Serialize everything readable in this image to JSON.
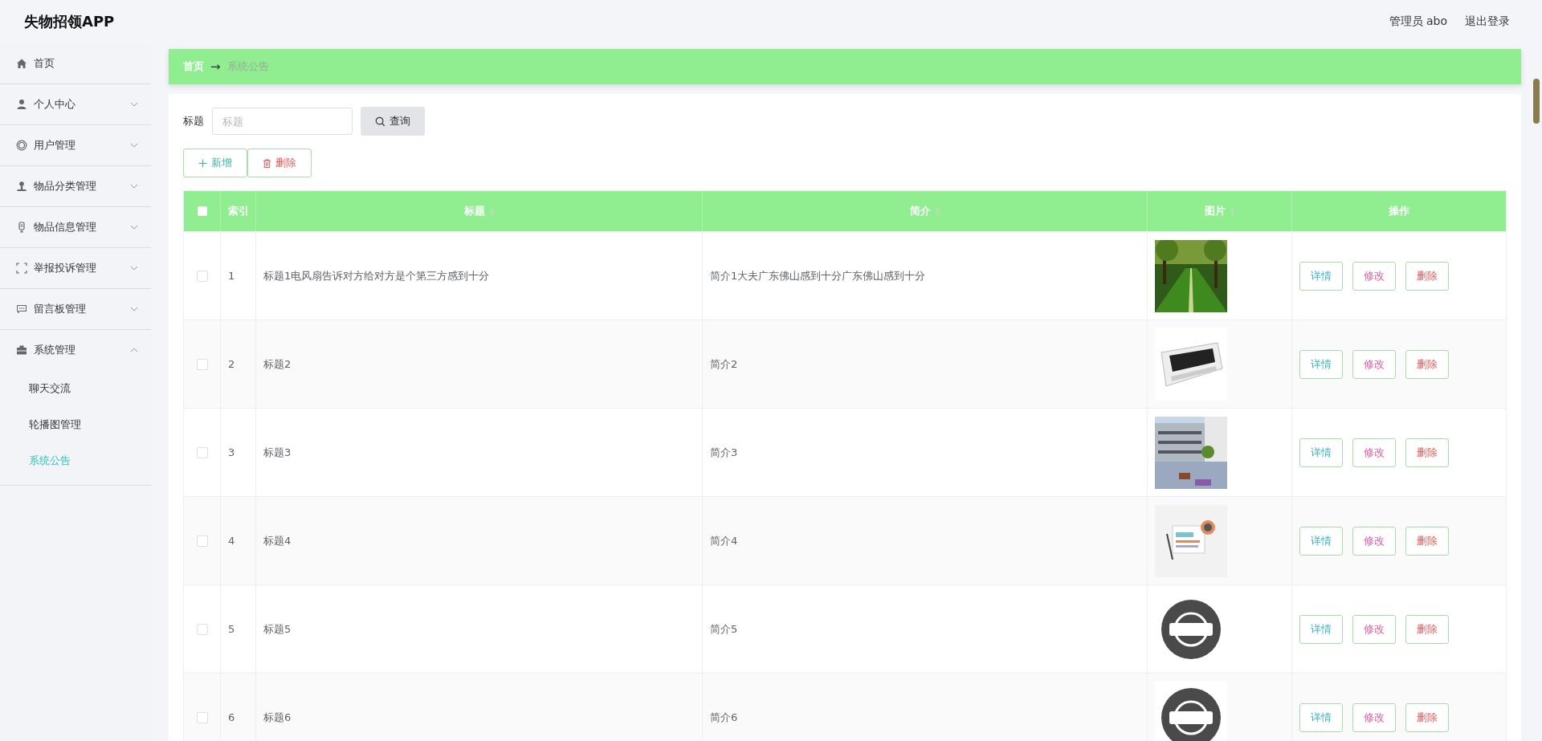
{
  "header": {
    "title": "失物招领APP",
    "user": "管理员 abo",
    "logout": "退出登录"
  },
  "sidebar": {
    "items": [
      {
        "label": "首页"
      },
      {
        "label": "个人中心",
        "expanded": false
      },
      {
        "label": "用户管理",
        "expanded": false
      },
      {
        "label": "物品分类管理",
        "expanded": false
      },
      {
        "label": "物品信息管理",
        "expanded": false
      },
      {
        "label": "举报投诉管理",
        "expanded": false
      },
      {
        "label": "留言板管理",
        "expanded": false
      },
      {
        "label": "系统管理",
        "expanded": true,
        "children": [
          {
            "label": "聊天交流",
            "selected": false
          },
          {
            "label": "轮播图管理",
            "selected": false
          },
          {
            "label": "系统公告",
            "selected": true
          }
        ]
      }
    ]
  },
  "breadcrumb": {
    "home": "首页",
    "arrow": "→",
    "current": "系统公告"
  },
  "search": {
    "label": "标题",
    "placeholder": "标题",
    "button": "查询"
  },
  "actions": {
    "add": "新增",
    "delete": "删除"
  },
  "table": {
    "select_all_checked": false,
    "columns": [
      {
        "kind": "check"
      },
      {
        "label": "索引",
        "sortable": false
      },
      {
        "label": "标题",
        "sortable": true
      },
      {
        "label": "简介",
        "sortable": true
      },
      {
        "label": "图片",
        "sortable": true
      },
      {
        "label": "操作",
        "sortable": false
      }
    ],
    "rows": [
      {
        "checked": false,
        "index": "1",
        "title": "标题1电风扇告诉对方给对方是个第三方感到十分",
        "intro": "简介1大夫广东佛山感到十分广东佛山感到十分",
        "buttons": [
          "详情",
          "修改",
          "删除"
        ]
      },
      {
        "checked": false,
        "index": "2",
        "title": "标题2",
        "intro": "简介2",
        "buttons": [
          "详情",
          "修改",
          "删除"
        ]
      },
      {
        "checked": false,
        "index": "3",
        "title": "标题3",
        "intro": "简介3",
        "buttons": [
          "详情",
          "修改",
          "删除"
        ]
      },
      {
        "checked": false,
        "index": "4",
        "title": "标题4",
        "intro": "简介4",
        "buttons": [
          "详情",
          "修改",
          "删除"
        ]
      },
      {
        "checked": false,
        "index": "5",
        "title": "标题5",
        "intro": "简介5",
        "buttons": [
          "详情",
          "修改",
          "删除"
        ]
      },
      {
        "checked": false,
        "index": "6",
        "title": "标题6",
        "intro": "简介6",
        "buttons": [
          "详情",
          "修改",
          "删除"
        ]
      }
    ]
  }
}
